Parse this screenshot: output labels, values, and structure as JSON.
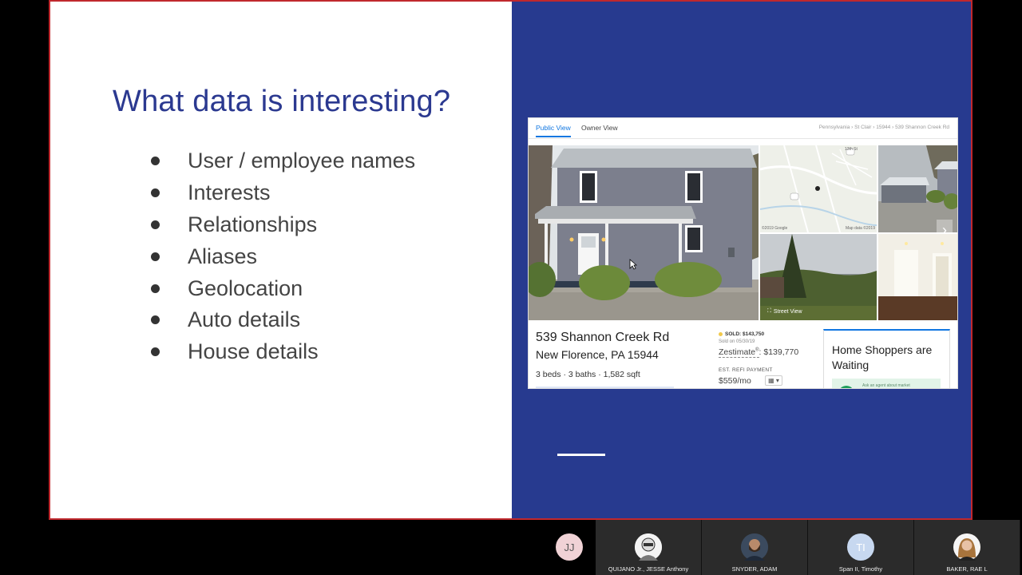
{
  "slide": {
    "title": "What data is interesting?",
    "bullets": [
      "User / employee names",
      "Interests",
      "Relationships",
      "Aliases",
      "Geolocation",
      "Auto details",
      "House details"
    ]
  },
  "listing": {
    "tabs": {
      "public": "Public View",
      "owner": "Owner View"
    },
    "breadcrumb": "Pennsylvania › St Clair › 15944 › 539 Shannon Creek Rd",
    "map_copyright": "©2019 Google",
    "map_data": "Map data ©2019",
    "map_street_label": "13th St",
    "street_view_label": "Street View",
    "address_line1": "539 Shannon Creek Rd",
    "address_line2": "New Florence, PA 15944",
    "specs": "3 beds · 3 baths · 1,582 sqft",
    "sold": "SOLD: $143,750",
    "sold_date": "Sold on 05/30/19",
    "zestimate_label": "Zestimate",
    "zestimate_sup": "®",
    "zestimate_value": ": $139,770",
    "refi_label": "EST. REFI PAYMENT",
    "refi_value": "$559/mo",
    "shoppers_title": "Home Shoppers are Waiting",
    "shoppers_banner_text": "Ask an agent about market"
  },
  "colors": {
    "slide_title": "#2b3990",
    "right_panel": "#273a8f",
    "border": "#c0282d",
    "accent": "#1277e1"
  },
  "participants": [
    {
      "initials": "JJ",
      "name": "",
      "avatar_color": "#f0d2d6"
    },
    {
      "initials": "",
      "name": "QUIJANO Jr., JESSE Anthony",
      "avatar_color": "#e8e8e8"
    },
    {
      "initials": "",
      "name": "SNYDER, ADAM",
      "avatar_color": "#3b4a5e"
    },
    {
      "initials": "TI",
      "name": "Span II, Timothy",
      "avatar_color": "#c7d8f0"
    },
    {
      "initials": "",
      "name": "BAKER, RAE L",
      "avatar_color": "#7a5a45"
    }
  ]
}
